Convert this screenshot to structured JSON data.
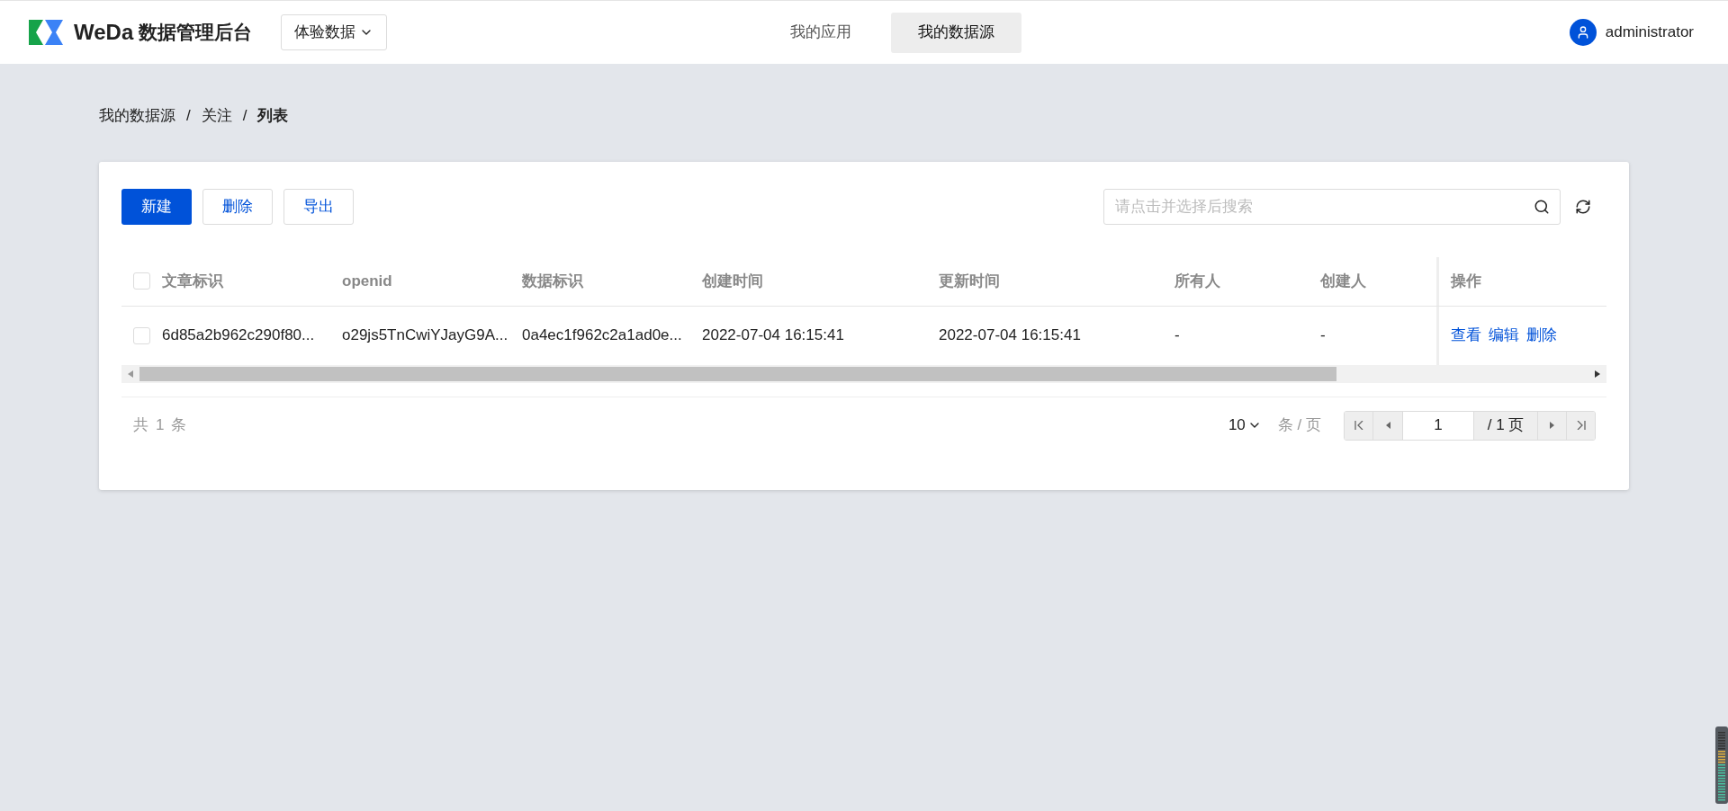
{
  "header": {
    "logo_text": "WeDa",
    "title": "数据管理后台",
    "env_select": "体验数据",
    "tabs": [
      {
        "label": "我的应用",
        "selected": false
      },
      {
        "label": "我的数据源",
        "selected": true
      }
    ],
    "user": "administrator"
  },
  "breadcrumb": [
    {
      "label": "我的数据源",
      "current": false
    },
    {
      "label": "关注",
      "current": false
    },
    {
      "label": "列表",
      "current": true
    }
  ],
  "breadcrumb_separator": "/",
  "toolbar": {
    "buttons": [
      {
        "label": "新建",
        "kind": "primary"
      },
      {
        "label": "删除",
        "kind": "default"
      },
      {
        "label": "导出",
        "kind": "default"
      }
    ],
    "search": {
      "placeholder": "请点击并选择后搜索"
    }
  },
  "table": {
    "select_all_checked": false,
    "columns": [
      "文章标识",
      "openid",
      "数据标识",
      "创建时间",
      "更新时间",
      "所有人",
      "创建人",
      "操作"
    ],
    "rows": [
      {
        "checked": false,
        "cells": [
          "6d85a2b962c290f80...",
          "o29js5TnCwiYJayG9A...",
          "0a4ec1f962c2a1ad0e...",
          "2022-07-04 16:15:41",
          "2022-07-04 16:15:41",
          "-",
          "-"
        ],
        "actions": [
          "查看",
          "编辑",
          "删除"
        ]
      }
    ]
  },
  "pagination": {
    "total_prefix": "共",
    "total": "1",
    "total_suffix": "条",
    "page_size": "10",
    "page_size_unit": "条 / 页",
    "page": "1",
    "page_count": "/ 1 页"
  }
}
